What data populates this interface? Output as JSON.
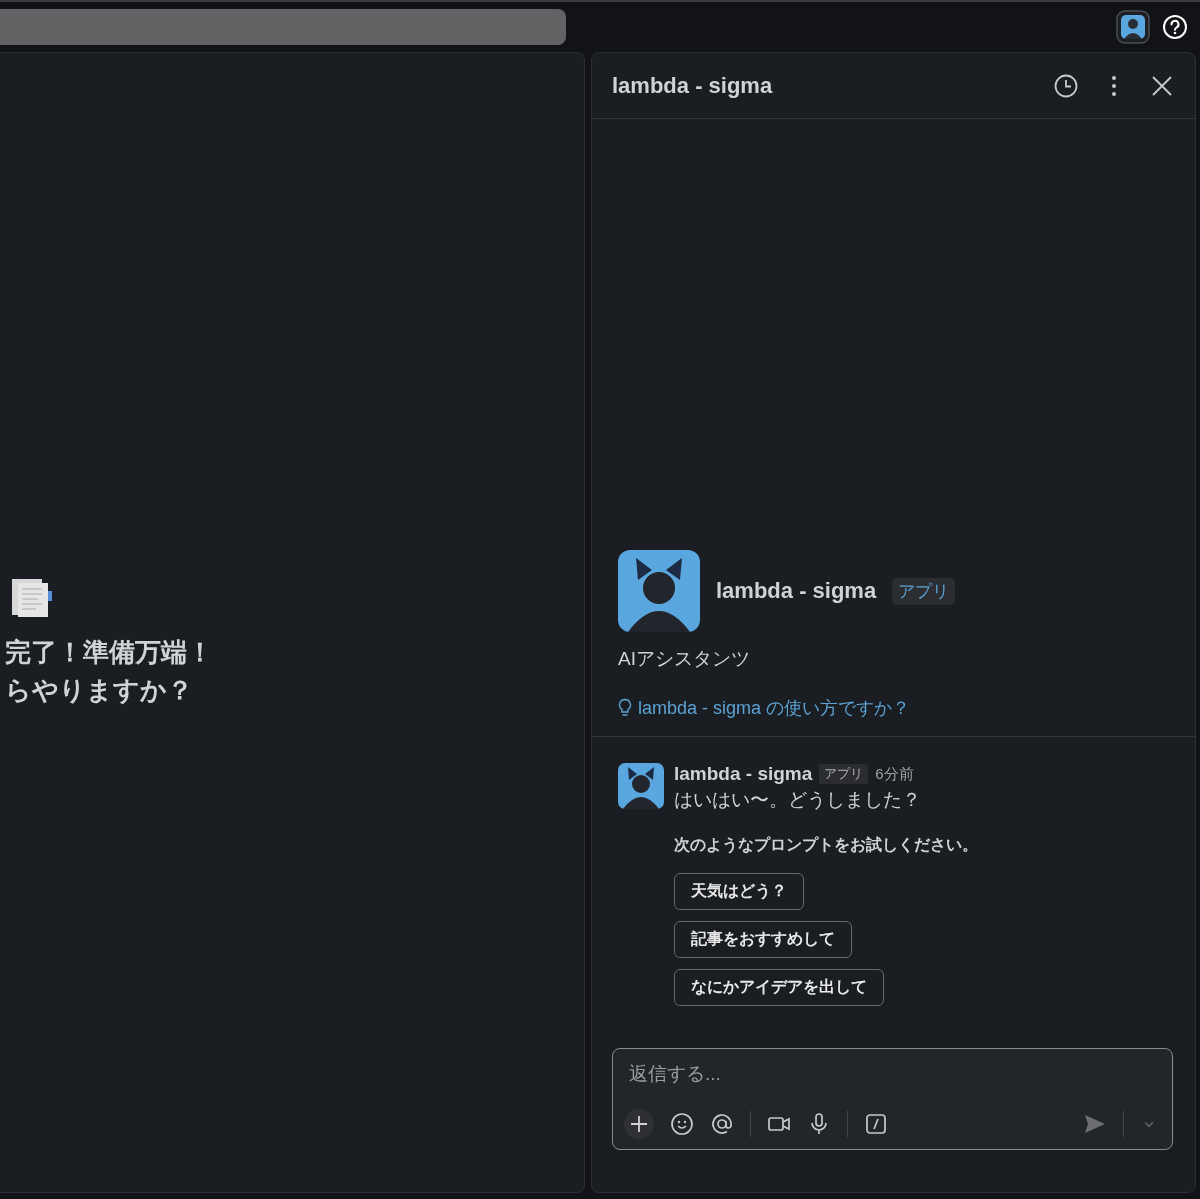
{
  "left_panel": {
    "message_lines": [
      "完了！準備万端！",
      "らやりますか？"
    ]
  },
  "thread_panel": {
    "title": "lambda - sigma",
    "intro": {
      "name": "lambda - sigma",
      "badge": "アプリ",
      "description": "AIアシスタンツ",
      "help_link": "lambda - sigma の使い方ですか？"
    },
    "messages": [
      {
        "name": "lambda - sigma",
        "badge": "アプリ",
        "time": "6分前",
        "text": "はいはい〜。どうしました？",
        "prompt_hint": "次のようなプロンプトをお試しください。",
        "prompts": [
          "天気はどう？",
          "記事をおすすめして",
          "なにかアイデアを出して"
        ]
      }
    ],
    "composer": {
      "placeholder": "返信する..."
    }
  }
}
